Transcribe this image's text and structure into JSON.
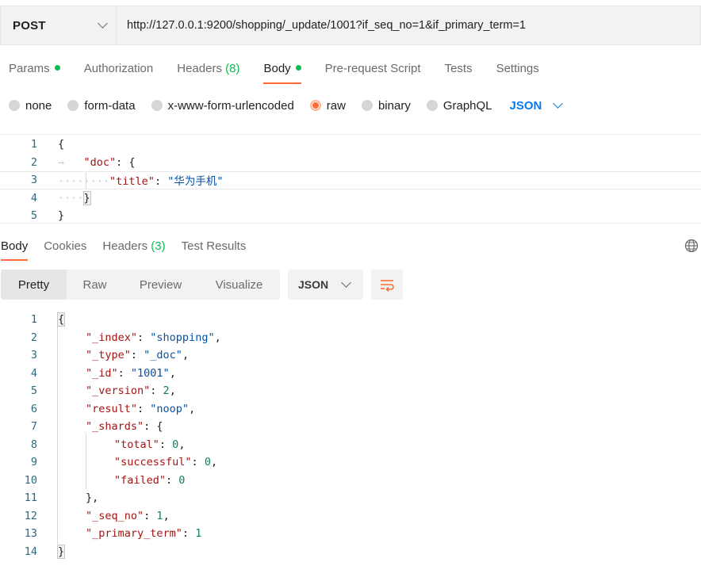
{
  "request": {
    "method": "POST",
    "url": "http://127.0.0.1:9200/shopping/_update/1001?if_seq_no=1&if_primary_term=1"
  },
  "request_tabs": [
    {
      "label": "Params",
      "dot": true
    },
    {
      "label": "Authorization"
    },
    {
      "label": "Headers",
      "count": "(8)"
    },
    {
      "label": "Body",
      "dot": true,
      "active": true
    },
    {
      "label": "Pre-request Script"
    },
    {
      "label": "Tests"
    },
    {
      "label": "Settings"
    }
  ],
  "body_types": [
    {
      "label": "none"
    },
    {
      "label": "form-data"
    },
    {
      "label": "x-www-form-urlencoded"
    },
    {
      "label": "raw",
      "selected": true
    },
    {
      "label": "binary"
    },
    {
      "label": "GraphQL"
    }
  ],
  "body_format": "JSON",
  "request_body_lines": [
    {
      "n": "1",
      "text": "{"
    },
    {
      "n": "2",
      "text": "\"doc\": {"
    },
    {
      "n": "3",
      "text": "\"title\": \"华为手机\""
    },
    {
      "n": "4",
      "text": "}"
    },
    {
      "n": "5",
      "text": "}"
    }
  ],
  "response_tabs": [
    {
      "label": "Body",
      "active": true
    },
    {
      "label": "Cookies"
    },
    {
      "label": "Headers",
      "count": "(3)"
    },
    {
      "label": "Test Results"
    }
  ],
  "view_modes": [
    "Pretty",
    "Raw",
    "Preview",
    "Visualize"
  ],
  "active_view": "Pretty",
  "response_format": "JSON",
  "response_lines": [
    {
      "n": "1",
      "text": "{"
    },
    {
      "n": "2",
      "text": "\"_index\": \"shopping\","
    },
    {
      "n": "3",
      "text": "\"_type\": \"_doc\","
    },
    {
      "n": "4",
      "text": "\"_id\": \"1001\","
    },
    {
      "n": "5",
      "text": "\"_version\": 2,"
    },
    {
      "n": "6",
      "text": "\"result\": \"noop\","
    },
    {
      "n": "7",
      "text": "\"_shards\": {"
    },
    {
      "n": "8",
      "text": "\"total\": 0,"
    },
    {
      "n": "9",
      "text": "\"successful\": 0,"
    },
    {
      "n": "10",
      "text": "\"failed\": 0"
    },
    {
      "n": "11",
      "text": "},"
    },
    {
      "n": "12",
      "text": "\"_seq_no\": 1,"
    },
    {
      "n": "13",
      "text": "\"_primary_term\": 1"
    },
    {
      "n": "14",
      "text": "}"
    }
  ],
  "colors": {
    "accent": "#ff6c37",
    "status_dot": "#0cbb52",
    "link_blue": "#097bed",
    "json_key": "#a31515",
    "json_string": "#0451a5",
    "json_number": "#098658",
    "line_number": "#2b6a80"
  },
  "icons": {
    "globe": "globe-icon",
    "wrap": "wrap-lines-icon",
    "dropdown": "chevron-down-icon"
  }
}
